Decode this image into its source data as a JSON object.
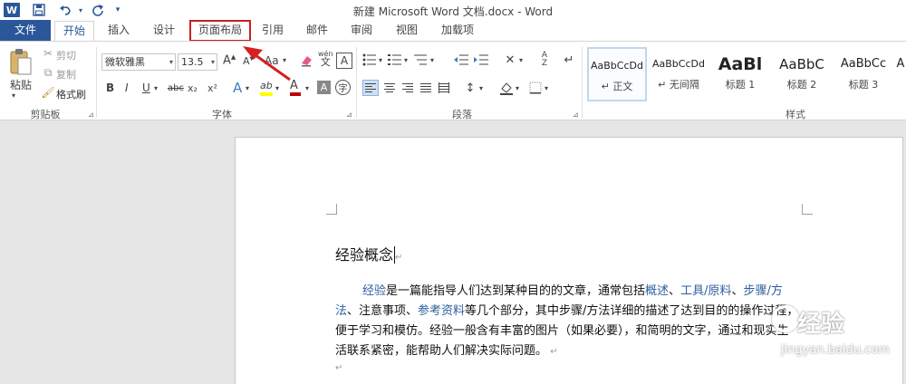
{
  "window": {
    "title": "新建 Microsoft Word 文档.docx - Word",
    "logo": "W",
    "quick_access": [
      "save-icon",
      "undo-icon",
      "redo-icon",
      "customize-icon"
    ]
  },
  "tabs": [
    {
      "label": "文件"
    },
    {
      "label": "开始"
    },
    {
      "label": "插入"
    },
    {
      "label": "设计"
    },
    {
      "label": "页面布局"
    },
    {
      "label": "引用"
    },
    {
      "label": "邮件"
    },
    {
      "label": "审阅"
    },
    {
      "label": "视图"
    },
    {
      "label": "加载项"
    }
  ],
  "clipboard": {
    "label": "剪贴板",
    "paste": "粘贴",
    "cut": "剪切",
    "copy": "复制",
    "format_painter": "格式刷"
  },
  "font": {
    "label": "字体",
    "family": "微软雅黑",
    "size": "13.5",
    "grow": "A",
    "shrink": "A",
    "case": "Aa",
    "phonetic": "wén",
    "bold": "B",
    "italic": "I",
    "underline": "U",
    "strike": "abc",
    "subscript": "x₂",
    "superscript": "x²",
    "effects": "A",
    "highlight": "ab",
    "color": "A",
    "shade": "A",
    "circle": "字",
    "highlight_color": "#ffff00",
    "font_color": "#c00000"
  },
  "paragraph": {
    "label": "段落"
  },
  "styles": {
    "label": "样式",
    "items": [
      {
        "sample": "AaBbCcDd",
        "name": "正文",
        "marker": "↵"
      },
      {
        "sample": "AaBbCcDd",
        "name": "无间隔",
        "marker": "↵"
      },
      {
        "sample": "AaBl",
        "name": "标题 1"
      },
      {
        "sample": "AaBbC",
        "name": "标题 2"
      },
      {
        "sample": "AaBbCc",
        "name": "标题 3"
      },
      {
        "sample": "A",
        "name": ""
      }
    ]
  },
  "document": {
    "heading": "经验概念",
    "para_mark": "↵",
    "lines": [
      [
        {
          "t": "经验",
          "link": true
        },
        {
          "t": "是一篇能指导人们达到某种目的的文章，通常包括"
        },
        {
          "t": "概述",
          "link": true
        },
        {
          "t": "、"
        },
        {
          "t": "工具/原料",
          "link": true
        },
        {
          "t": "、"
        },
        {
          "t": "步骤/方",
          "link": true
        }
      ],
      [
        {
          "t": "法",
          "link": true
        },
        {
          "t": "、注意事项、"
        },
        {
          "t": "参考资料",
          "link": true
        },
        {
          "t": "等几个部分，其中步骤/方法详细的描述了达到目的的操作过程，"
        }
      ],
      [
        {
          "t": "便于学习和模仿。经验一般含有丰富的图片（如果必要），和简明的文字，通过和现实生"
        }
      ],
      [
        {
          "t": "活联系紧密，能帮助人们解决实际问题。"
        }
      ]
    ]
  },
  "watermark": {
    "title": "经验",
    "url": "jingyan.baidu.com"
  },
  "colors": {
    "accent": "#2b579a",
    "highlight_box": "#cc1f1f",
    "link": "#2e5e9e"
  }
}
